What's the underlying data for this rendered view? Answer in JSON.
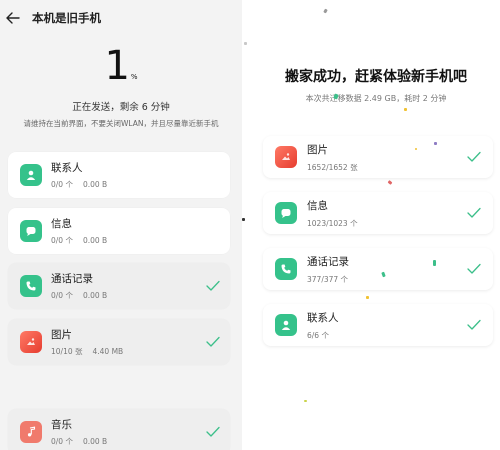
{
  "left": {
    "header_title": "本机是旧手机",
    "percent": "1",
    "percent_sign": "%",
    "status_main": "正在发送，剩余 6 分钟",
    "status_sub": "请维持在当前界面，不要关闭WLAN，并且尽量靠近新手机",
    "items": [
      {
        "title": "联系人",
        "count": "0/0 个",
        "size": "0.00 B",
        "icon": "contact-icon",
        "done": false
      },
      {
        "title": "信息",
        "count": "0/0 个",
        "size": "0.00 B",
        "icon": "message-icon",
        "done": false
      },
      {
        "title": "通话记录",
        "count": "0/0 个",
        "size": "0.00 B",
        "icon": "phone-icon",
        "done": true
      },
      {
        "title": "图片",
        "count": "10/10 张",
        "size": "4.40 MB",
        "icon": "photo-icon",
        "done": true
      },
      {
        "title": "音乐",
        "count": "0/0 个",
        "size": "0.00 B",
        "icon": "music-icon",
        "done": true
      }
    ]
  },
  "right": {
    "title": "搬家成功，赶紧体验新手机吧",
    "subtitle": "本次共迁移数据 2.49 GB，耗时 2 分钟",
    "items": [
      {
        "title": "图片",
        "count": "1652/1652 张",
        "icon": "photo-icon"
      },
      {
        "title": "信息",
        "count": "1023/1023 个",
        "icon": "message-icon"
      },
      {
        "title": "通话记录",
        "count": "377/377 个",
        "icon": "phone-icon"
      },
      {
        "title": "联系人",
        "count": "6/6 个",
        "icon": "contact-icon"
      }
    ]
  },
  "colors": {
    "accent_green": "#35c28b",
    "check_green": "#3cbf8a",
    "photo_red": "#ef5b4b",
    "music_red": "#f07a6c"
  }
}
